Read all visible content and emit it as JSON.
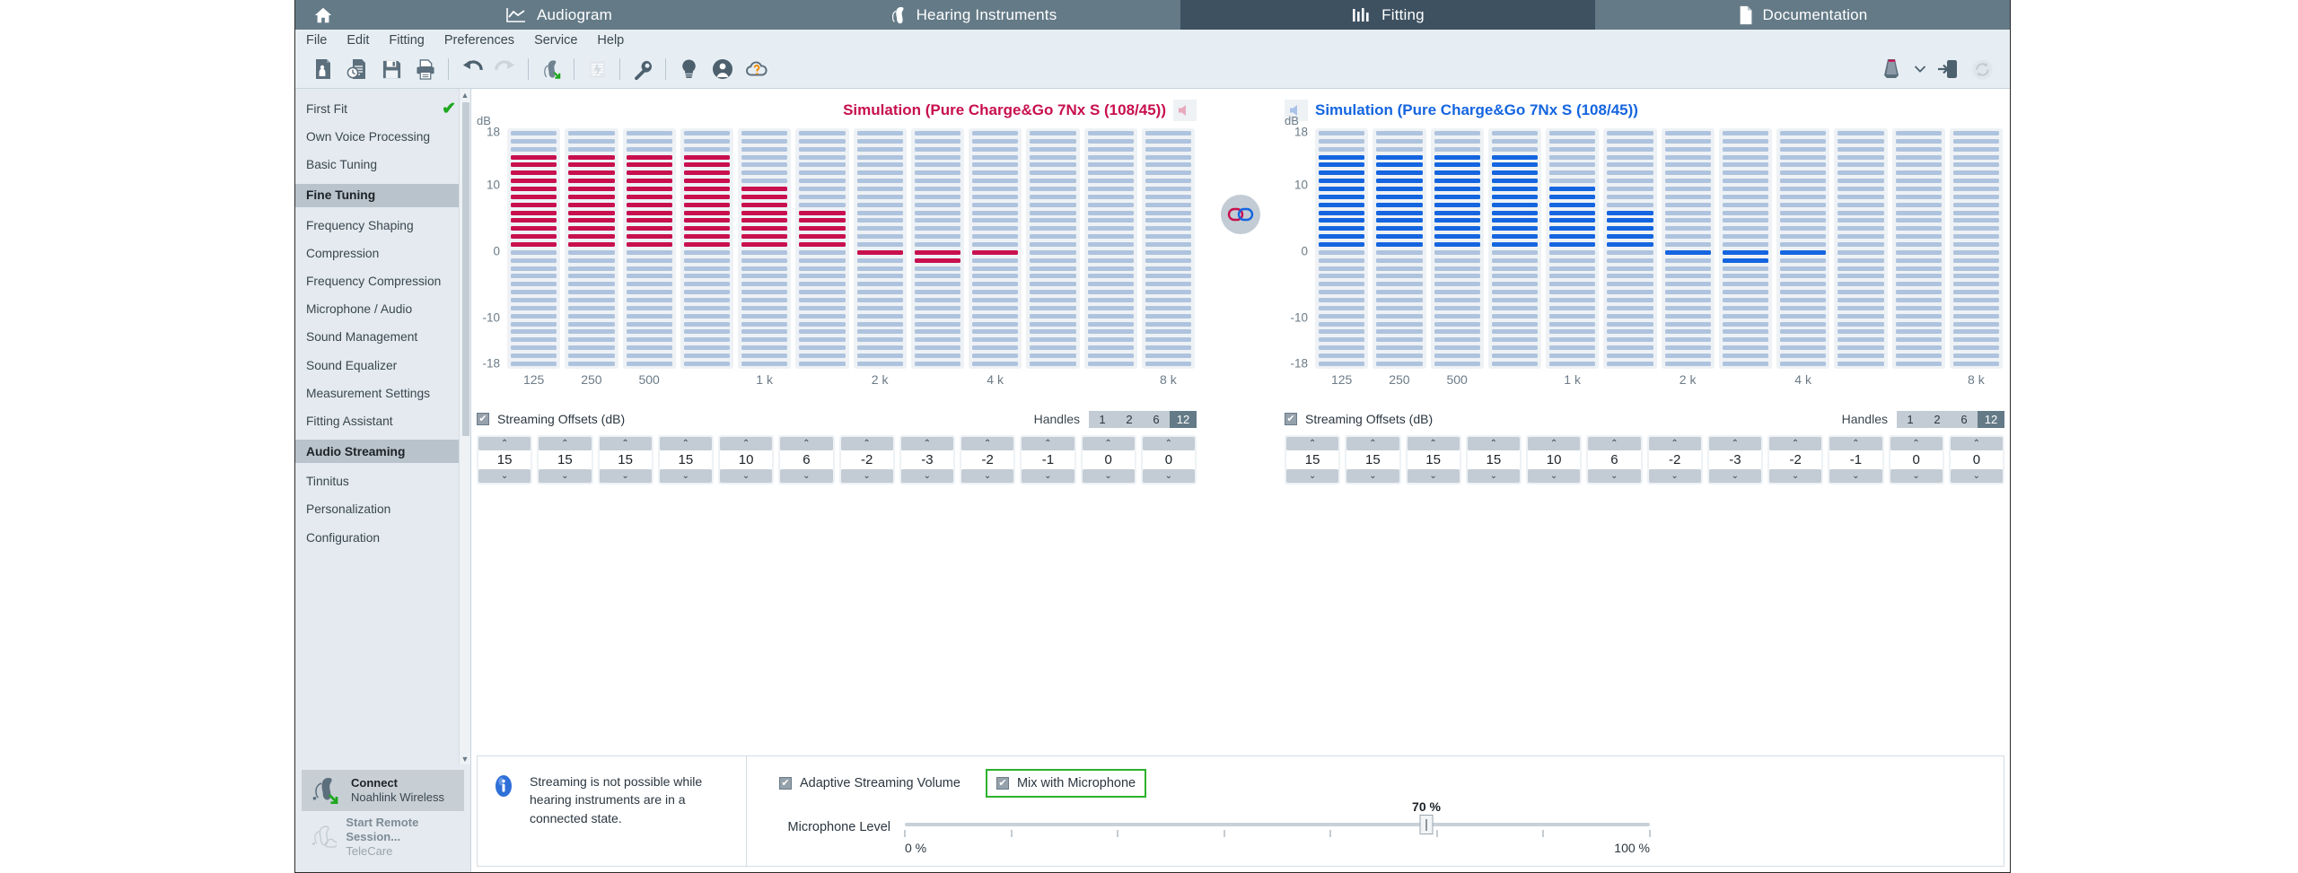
{
  "modules": {
    "home_icon": "home-icon",
    "tabs": [
      {
        "label": "Audiogram",
        "icon": "audiogram-icon",
        "active": false
      },
      {
        "label": "Hearing Instruments",
        "icon": "hearing-instrument-icon",
        "active": false
      },
      {
        "label": "Fitting",
        "icon": "fitting-bars-icon",
        "active": true
      },
      {
        "label": "Documentation",
        "icon": "document-icon",
        "active": false
      }
    ]
  },
  "menu": [
    "File",
    "Edit",
    "Fitting",
    "Preferences",
    "Service",
    "Help"
  ],
  "toolbar": {
    "left_icons": [
      "client-record-icon",
      "session-history-icon",
      "save-icon",
      "print-icon",
      "undo-icon",
      "redo-icon",
      "hearing-instrument-connect-icon",
      "report-icon",
      "wrench-icon",
      "lightbulb-icon",
      "user-icon",
      "cloud-help-icon"
    ],
    "right_icons": [
      "noahlink-device-icon",
      "chevron-down-icon",
      "login-icon",
      "sync-icon"
    ]
  },
  "sidebar": {
    "items": [
      {
        "label": "First Fit",
        "checked": true,
        "selected": false,
        "group": false
      },
      {
        "label": "Own Voice Processing",
        "checked": false,
        "selected": false,
        "group": false
      },
      {
        "label": "Basic Tuning",
        "checked": false,
        "selected": false,
        "group": false
      },
      {
        "label": "Fine Tuning",
        "checked": false,
        "selected": true,
        "group": true
      },
      {
        "label": "Frequency Shaping",
        "checked": false,
        "selected": false,
        "group": false
      },
      {
        "label": "Compression",
        "checked": false,
        "selected": false,
        "group": false
      },
      {
        "label": "Frequency Compression",
        "checked": false,
        "selected": false,
        "group": false
      },
      {
        "label": "Microphone / Audio",
        "checked": false,
        "selected": false,
        "group": false
      },
      {
        "label": "Sound Management",
        "checked": false,
        "selected": false,
        "group": false
      },
      {
        "label": "Sound Equalizer",
        "checked": false,
        "selected": false,
        "group": false
      },
      {
        "label": "Measurement Settings",
        "checked": false,
        "selected": false,
        "group": false
      },
      {
        "label": "Fitting Assistant",
        "checked": false,
        "selected": false,
        "group": false
      },
      {
        "label": "Audio Streaming",
        "checked": false,
        "selected": true,
        "group": true
      },
      {
        "label": "Tinnitus",
        "checked": false,
        "selected": false,
        "group": false
      },
      {
        "label": "Personalization",
        "checked": false,
        "selected": false,
        "group": false
      },
      {
        "label": "Configuration",
        "checked": false,
        "selected": false,
        "group": false
      }
    ],
    "connect": {
      "title": "Connect",
      "subtitle": "Noahlink Wireless",
      "icon": "hearing-instrument-connect-icon"
    },
    "remote": {
      "title": "Start Remote Session...",
      "subtitle": "TeleCare",
      "icon": "hearing-instrument-cloud-icon"
    }
  },
  "left_panel": {
    "title": "Simulation (Pure Charge&Go 7Nx S (108/45))",
    "title_color": "#c8104e",
    "speaker_icon": "speaker-icon",
    "offsets_label": "Streaming Offsets (dB)",
    "offsets_checked": true,
    "handles_label": "Handles",
    "handles_options": [
      "1",
      "2",
      "6",
      "12"
    ],
    "handles_selected": "12",
    "values": [
      15,
      15,
      15,
      15,
      10,
      6,
      -2,
      -3,
      -2,
      -1,
      0,
      0
    ]
  },
  "right_panel": {
    "title": "Simulation (Pure Charge&Go 7Nx S (108/45))",
    "title_color": "#1565e0",
    "speaker_icon": "speaker-icon",
    "offsets_label": "Streaming Offsets (dB)",
    "offsets_checked": true,
    "handles_label": "Handles",
    "handles_options": [
      "1",
      "2",
      "6",
      "12"
    ],
    "handles_selected": "12",
    "values": [
      15,
      15,
      15,
      15,
      10,
      6,
      -2,
      -3,
      -2,
      -1,
      0,
      0
    ]
  },
  "link_toggle": {
    "icon": "link-ears-icon",
    "linked": true
  },
  "info": {
    "icon": "info-icon",
    "text": "Streaming is not possible while hearing instruments are in a connected state."
  },
  "controls": {
    "adaptive": {
      "label": "Adaptive Streaming Volume",
      "checked": true,
      "highlight": false
    },
    "mix": {
      "label": "Mix with Microphone",
      "checked": true,
      "highlight": true
    },
    "slider": {
      "label": "Microphone Level",
      "value": "70 %",
      "value_pct": 70,
      "min_label": "0 %",
      "max_label": "100 %",
      "ticks": [
        0,
        14.3,
        28.6,
        42.9,
        57.1,
        71.4,
        85.7,
        100
      ]
    }
  },
  "chart_data": {
    "type": "bar",
    "title": "Streaming Offsets (dB) — Simulation (Pure Charge&Go 7Nx S (108/45))",
    "xlabel": "",
    "ylabel": "dB",
    "ylim": [
      -18,
      18
    ],
    "yticks": [
      18,
      10,
      0,
      -10,
      -18
    ],
    "categories": [
      "125",
      "250",
      "500",
      "",
      "1 k",
      "",
      "2 k",
      "",
      "4 k",
      "",
      "",
      "8 k"
    ],
    "tick_labels_shown": [
      "125",
      "250",
      "500",
      "1 k",
      "2 k",
      "4 k",
      "8 k"
    ],
    "grid": false,
    "legend": "none",
    "series": [
      {
        "name": "Left (Simulation, red)",
        "color": "#c8104e",
        "values": [
          15,
          15,
          15,
          15,
          10,
          6,
          -2,
          -3,
          -2,
          -1,
          0,
          0
        ]
      },
      {
        "name": "Right (Simulation, blue)",
        "color": "#1565e0",
        "values": [
          15,
          15,
          15,
          15,
          10,
          6,
          -2,
          -3,
          -2,
          -1,
          0,
          0
        ]
      }
    ]
  }
}
